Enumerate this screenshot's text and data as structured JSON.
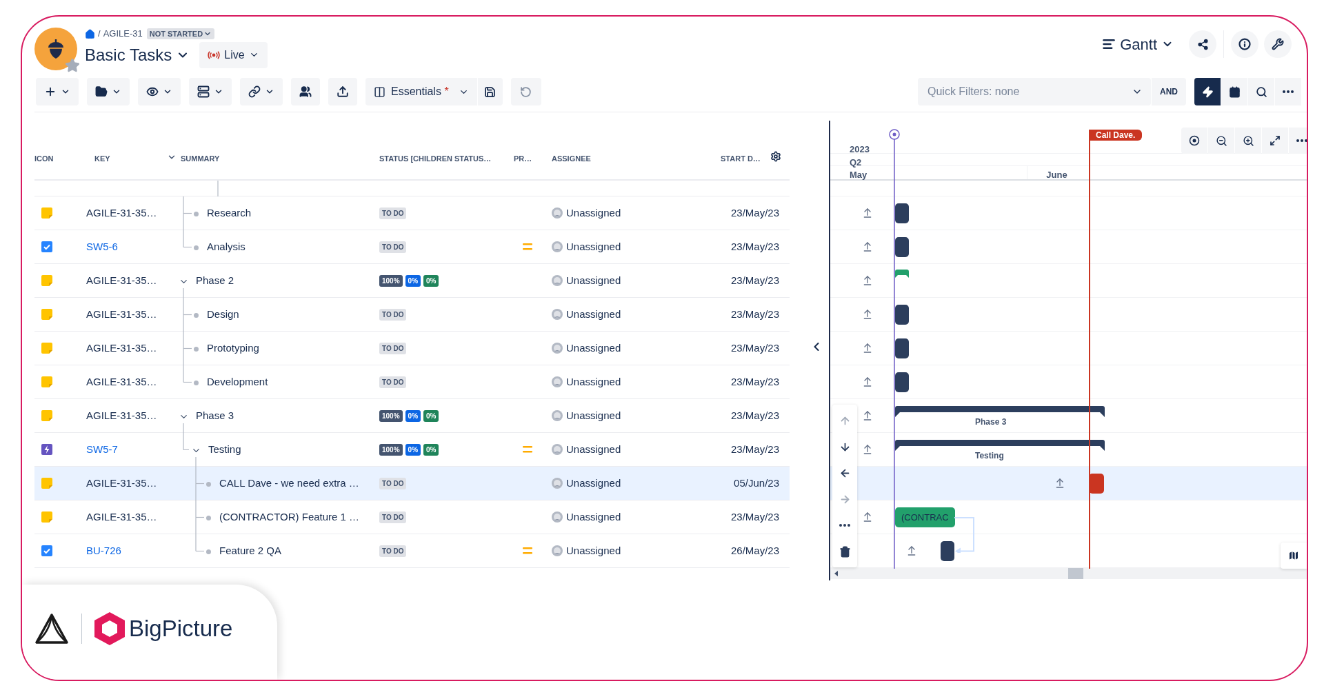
{
  "header": {
    "breadcrumb": {
      "separator": "/",
      "project": "AGILE-31",
      "status": "NOT STARTED"
    },
    "title": "Basic Tasks",
    "mode": "Live",
    "view_switch": "Gantt"
  },
  "toolbar": {
    "buttons": [
      {
        "kind": "add",
        "dropdown": true
      },
      {
        "kind": "folder",
        "dropdown": true
      },
      {
        "kind": "eye",
        "dropdown": true
      },
      {
        "kind": "rows",
        "dropdown": true
      },
      {
        "kind": "link",
        "dropdown": true
      },
      {
        "kind": "people",
        "dropdown": false
      },
      {
        "kind": "export",
        "dropdown": false
      }
    ],
    "view": {
      "label": "Essentials",
      "marker": "*"
    },
    "quick_filters": {
      "placeholder": "Quick Filters: none"
    },
    "operator": "AND",
    "tools": [
      {
        "kind": "lightning",
        "selected": true
      },
      {
        "kind": "calendar",
        "selected": false
      },
      {
        "kind": "search",
        "selected": false
      },
      {
        "kind": "more",
        "selected": false
      }
    ]
  },
  "table": {
    "columns": [
      "ICON",
      "KEY",
      "SUMMARY",
      "STATUS [CHILDREN STATUS…",
      "PR…",
      "ASSIGNEE",
      "START D…"
    ],
    "rows": [
      {
        "kind": "scrolled",
        "children": [
          {
            "kind": "story",
            "key": "AGILE-31-35…",
            "link": false,
            "summary": "Research",
            "status": {
              "label": "TO DO"
            },
            "assignee": "Unassigned",
            "start": "23/May/23",
            "selected": false,
            "bar": {
              "kind": "block"
            }
          },
          {
            "kind": "task",
            "key": "SW5-6",
            "link": true,
            "summary": "Analysis",
            "status": {
              "label": "TO DO"
            },
            "priority": {
              "kind": "medium"
            },
            "assignee": "Unassigned",
            "start": "23/May/23",
            "selected": false,
            "bar": {
              "kind": "block"
            }
          }
        ]
      },
      {
        "kind": "story",
        "key": "AGILE-31-35…",
        "link": false,
        "summary": "Phase 2",
        "expanded": true,
        "progress": [
          {
            "label": "100%",
            "color": "#44546f"
          },
          {
            "label": "0%",
            "color": "#0c66e4"
          },
          {
            "label": "0%",
            "color": "#1f845a"
          }
        ],
        "assignee": "Unassigned",
        "start": "23/May/23",
        "selected": false,
        "bar": {
          "kind": "cap"
        },
        "children": [
          {
            "kind": "story",
            "key": "AGILE-31-35…",
            "link": false,
            "summary": "Design",
            "status": {
              "label": "TO DO"
            },
            "assignee": "Unassigned",
            "start": "23/May/23",
            "selected": false,
            "bar": {
              "kind": "block"
            }
          },
          {
            "kind": "story",
            "key": "AGILE-31-35…",
            "link": false,
            "summary": "Prototyping",
            "status": {
              "label": "TO DO"
            },
            "assignee": "Unassigned",
            "start": "23/May/23",
            "selected": false,
            "bar": {
              "kind": "block"
            }
          },
          {
            "kind": "story",
            "key": "AGILE-31-35…",
            "link": false,
            "summary": "Development",
            "status": {
              "label": "TO DO"
            },
            "assignee": "Unassigned",
            "start": "23/May/23",
            "selected": false,
            "bar": {
              "kind": "block"
            }
          }
        ]
      },
      {
        "kind": "story",
        "key": "AGILE-31-35…",
        "link": false,
        "summary": "Phase 3",
        "expanded": true,
        "progress": [
          {
            "label": "100%",
            "color": "#44546f"
          },
          {
            "label": "0%",
            "color": "#0c66e4"
          },
          {
            "label": "0%",
            "color": "#1f845a"
          }
        ],
        "assignee": "Unassigned",
        "start": "23/May/23",
        "selected": false,
        "bar": {
          "kind": "bracket",
          "label": "Phase 3"
        },
        "children": [
          {
            "kind": "epic",
            "key": "SW5-7",
            "link": true,
            "summary": "Testing",
            "expanded": true,
            "progress": [
              {
                "label": "100%",
                "color": "#44546f"
              },
              {
                "label": "0%",
                "color": "#0c66e4"
              },
              {
                "label": "0%",
                "color": "#1f845a"
              }
            ],
            "priority": {
              "kind": "medium"
            },
            "assignee": "Unassigned",
            "start": "23/May/23",
            "selected": false,
            "bar": {
              "kind": "bracket",
              "label": "Testing"
            },
            "children": [
              {
                "kind": "story",
                "key": "AGILE-31-35…",
                "link": false,
                "summary": "CALL Dave - we need extra …",
                "status": {
                  "label": "TO DO"
                },
                "assignee": "Unassigned",
                "start": "05/Jun/23",
                "selected": true,
                "bar": {
                  "kind": "overdue"
                }
              },
              {
                "kind": "story",
                "key": "AGILE-31-35…",
                "link": false,
                "summary": "(CONTRACTOR) Feature 1 …",
                "status": {
                  "label": "TO DO"
                },
                "assignee": "Unassigned",
                "start": "23/May/23",
                "selected": false,
                "bar": {
                  "kind": "labeled",
                  "label": "(CONTRAC"
                }
              },
              {
                "kind": "task",
                "key": "BU-726",
                "link": true,
                "summary": "Feature 2 QA",
                "status": {
                  "label": "TO DO"
                },
                "priority": {
                  "kind": "medium"
                },
                "assignee": "Unassigned",
                "start": "26/May/23",
                "selected": false,
                "bar": {
                  "kind": "offset"
                }
              }
            ]
          }
        ]
      }
    ]
  },
  "gantt": {
    "year": "2023",
    "quarter": "Q2",
    "months": [
      "May",
      "June"
    ],
    "marker": "Call Dave.",
    "nav": [
      {
        "kind": "up",
        "disabled": true
      },
      {
        "kind": "down",
        "disabled": false
      },
      {
        "kind": "left",
        "disabled": false
      },
      {
        "kind": "right",
        "disabled": true
      },
      {
        "kind": "more",
        "disabled": false
      },
      {
        "kind": "trash",
        "disabled": false
      }
    ]
  },
  "brand": "BigPicture"
}
